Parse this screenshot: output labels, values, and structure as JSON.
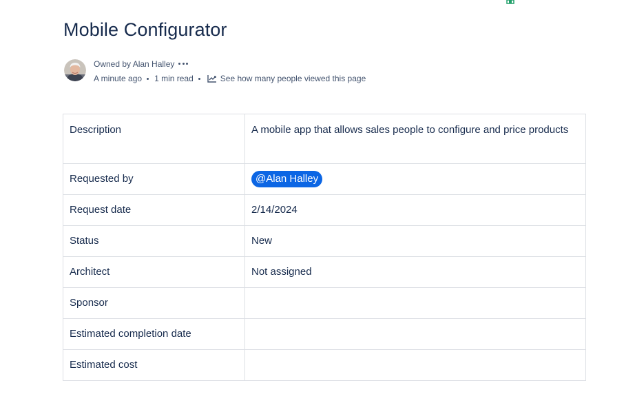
{
  "page": {
    "title": "Mobile Configurator"
  },
  "byline": {
    "owner": "Owned by Alan Halley",
    "updated": "A minute ago",
    "read_time": "1 min read",
    "views_link": "See how many people viewed this page",
    "avatar_icon": "user-photo",
    "more_icon": "more-horizontal-icon",
    "views_icon": "analytics-line-icon"
  },
  "table": {
    "rows": [
      {
        "label": "Description",
        "value": "A mobile app that allows sales people to configure and price products"
      },
      {
        "label": "Requested by",
        "mention": "@Alan Halley"
      },
      {
        "label": "Request date",
        "value": "2/14/2024"
      },
      {
        "label": "Status",
        "value": "New"
      },
      {
        "label": "Architect",
        "value": "Not assigned"
      },
      {
        "label": "Sponsor",
        "value": ""
      },
      {
        "label": "Estimated completion date",
        "value": ""
      },
      {
        "label": "Estimated cost",
        "value": ""
      }
    ]
  },
  "colors": {
    "mention_bg": "#0c66e4",
    "text": "#172b4d",
    "subtle_text": "#44546f",
    "border": "#dcdfe4"
  }
}
